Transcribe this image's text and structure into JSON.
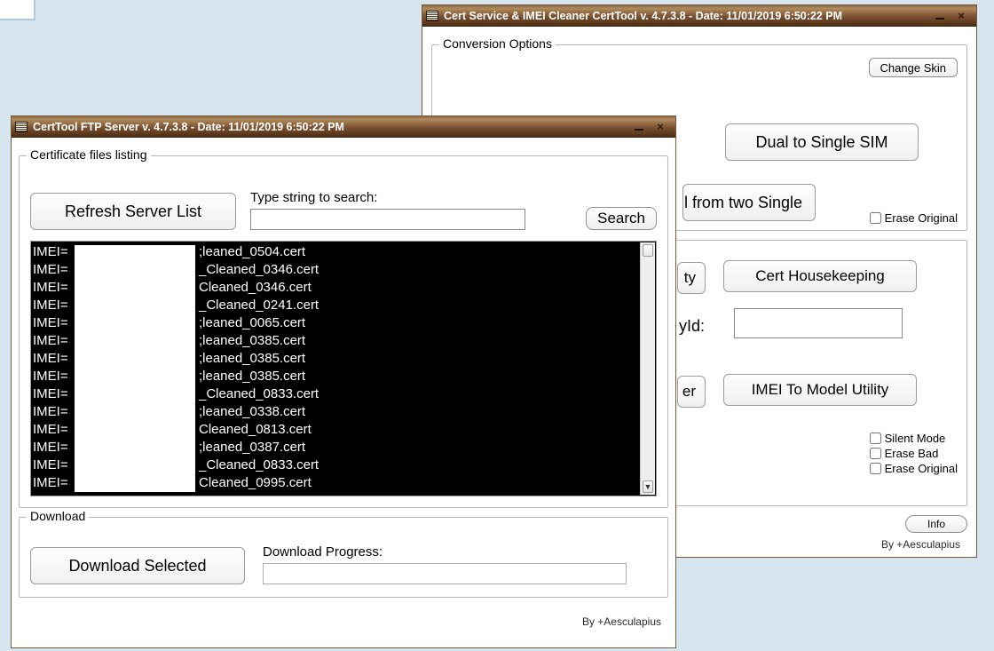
{
  "back_window": {
    "title": "Cert Service & IMEI Cleaner CertTool v. 4.7.3.8 - Date: 11/01/2019 6:50:22 PM",
    "group_conversion": "Conversion Options",
    "btn_change_skin": "Change Skin",
    "btn_dual_to_single": "Dual to Single SIM",
    "btn_from_two_single": "l from two Single",
    "chk_erase_original_top": "Erase Original",
    "btn_ty_partial": "ty",
    "btn_cert_housekeeping": "Cert Housekeeping",
    "lbl_yid": "yId:",
    "btn_er_partial": "er",
    "btn_imei_to_model": "IMEI To Model Utility",
    "chk_silent_mode": "Silent Mode",
    "chk_erase_bad": "Erase Bad",
    "chk_erase_original_bottom": "Erase Original",
    "btn_info": "Info",
    "signature": "By +Aesculapius"
  },
  "front_window": {
    "title": "CertTool FTP Server v. 4.7.3.8 - Date: 11/01/2019 6:50:22 PM",
    "group_listing": "Certificate files listing",
    "btn_refresh": "Refresh Server List",
    "lbl_search": "Type string to search:",
    "btn_search": "Search",
    "list_items": [
      {
        "imei": "IMEI=",
        "rest": ";leaned_0504.cert"
      },
      {
        "imei": "IMEI=",
        "rest": "_Cleaned_0346.cert"
      },
      {
        "imei": "IMEI=",
        "rest": "Cleaned_0346.cert"
      },
      {
        "imei": "IMEI=",
        "rest": "_Cleaned_0241.cert"
      },
      {
        "imei": "IMEI=",
        "rest": ";leaned_0065.cert"
      },
      {
        "imei": "IMEI=",
        "rest": ";leaned_0385.cert"
      },
      {
        "imei": "IMEI=",
        "rest": ";leaned_0385.cert"
      },
      {
        "imei": "IMEI=",
        "rest": ";leaned_0385.cert"
      },
      {
        "imei": "IMEI=",
        "rest": "_Cleaned_0833.cert"
      },
      {
        "imei": "IMEI=",
        "rest": ";leaned_0338.cert"
      },
      {
        "imei": "IMEI=",
        "rest": "Cleaned_0813.cert"
      },
      {
        "imei": "IMEI=",
        "rest": ";leaned_0387.cert"
      },
      {
        "imei": "IMEI=",
        "rest": "_Cleaned_0833.cert"
      },
      {
        "imei": "IMEI=",
        "rest": "Cleaned_0995.cert"
      }
    ],
    "group_download": "Download",
    "btn_download_selected": "Download Selected",
    "lbl_download_progress": "Download Progress:",
    "signature": "By +Aesculapius"
  }
}
